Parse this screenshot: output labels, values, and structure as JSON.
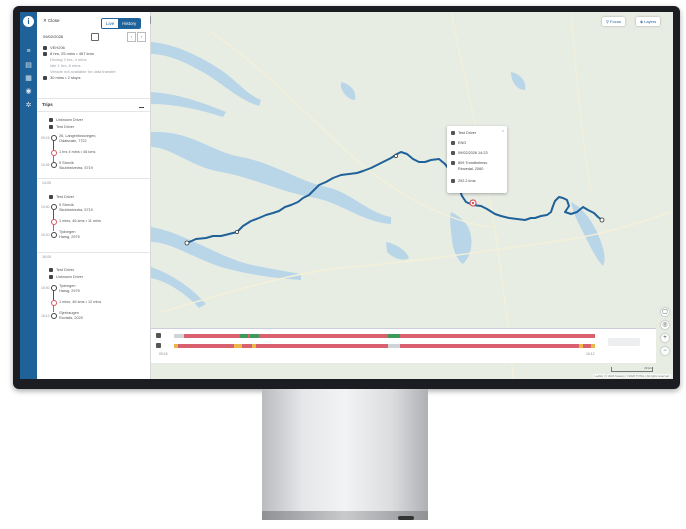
{
  "header": {
    "close_label": "✕ Close",
    "live_label": "Live",
    "history_label": "History"
  },
  "date": {
    "value": "09/02/2026",
    "prev": "‹",
    "next": "›"
  },
  "vehicle": {
    "name": "VEH206",
    "summary": "8 hrs, 25 mins • 467 kms",
    "line1": "Driving 3 hrs, 4 mins",
    "line2": "Idle 1 hrs, 8 mins",
    "line3": "Vehicle not available for data transfer",
    "line4": "30 mins • 2 stops"
  },
  "trips": {
    "title": "Trips",
    "groups": [
      {
        "drivers": [
          "Unknown Driver",
          "Test Driver"
        ],
        "start_time": "09:15",
        "start_addr1": "26, Langenfossvegen,",
        "start_addr2": "Odalsvatn, 7722",
        "mid_note": "1 hrs 4 mins • 46 kms",
        "end_time": "10:45",
        "end_addr1": "5 Storvik",
        "end_addr2": "Skubbstvedra, 5719"
      },
      {
        "date": "14:05",
        "drivers": [
          "Test Driver"
        ],
        "start_time": "14:40",
        "start_addr1": "5 Storvik",
        "start_addr2": "Skubbstvedra, 5719",
        "mid_note": "1 mins, 46 kms • 11 mins",
        "end_time": "15:20",
        "end_addr1": "Tydvegen",
        "end_addr2": "Harsg, 2975"
      },
      {
        "date": "16:05",
        "drivers": [
          "Test Driver",
          "Unknown Driver"
        ],
        "start_time": "15:00",
        "start_addr1": "Tydvegen",
        "start_addr2": "Harsg, 2975",
        "mid_note": "1 mins, 46 kms • 12 mins",
        "end_time": "16:12",
        "end_addr1": "Gjerhaugen",
        "end_addr2": "Rovistis, 2020"
      }
    ]
  },
  "map": {
    "focus_label": "Focus",
    "layers_label": "Layers",
    "popup": {
      "driver": "Test Driver",
      "status": "ENG",
      "datetime": "09/02/2026 14:23",
      "location_1": "809 Trondheimsv.",
      "location_2": "Rinvedal, 2060",
      "distance": "292.2 kms"
    },
    "scale_label": "20 km",
    "attribution": "Leaflet | © 2026 Sokanp | ©2026 TOTAL | All rights reserved"
  },
  "timeline": {
    "start_time": "09:15",
    "end_time": "16:12"
  },
  "colors": {
    "brand": "#1f6299",
    "route": "#1f6299",
    "idle_bar": "#d9606e",
    "drive_bar": "#3d9a5b",
    "warn_bar": "#e8b84a"
  },
  "icons": {
    "rail": [
      "info-icon",
      "list-icon",
      "menu-icon",
      "calendar-icon",
      "globe-icon",
      "settings-icon"
    ]
  }
}
